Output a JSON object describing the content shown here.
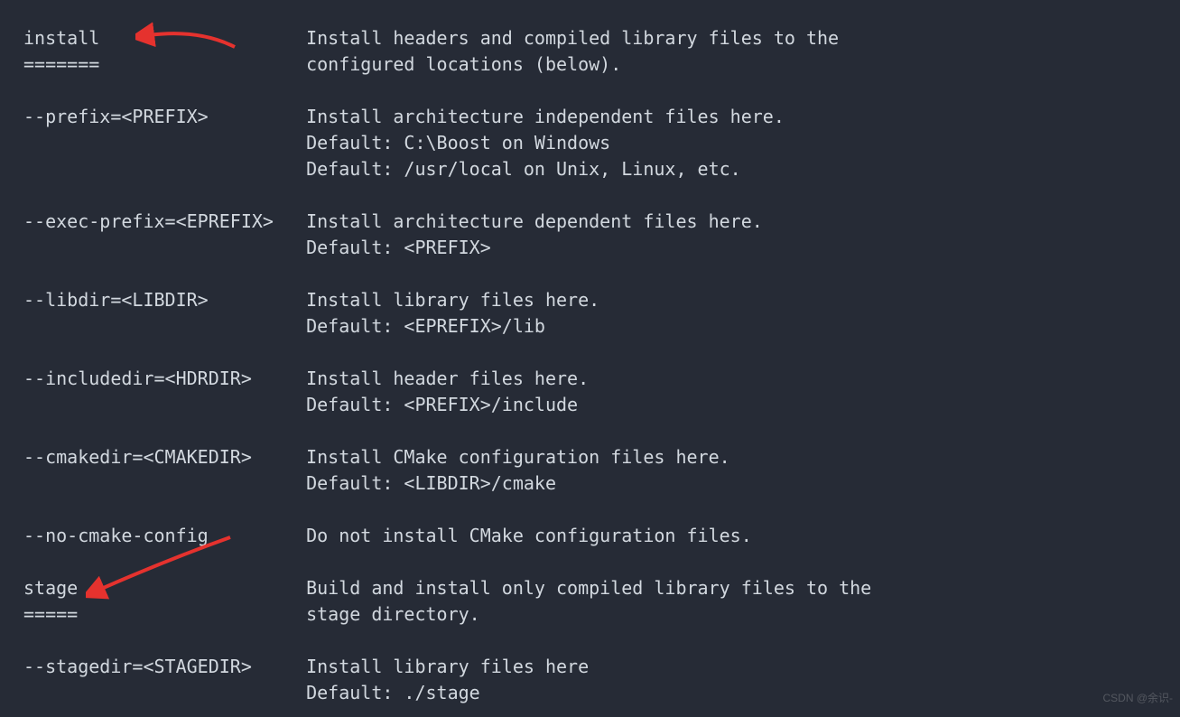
{
  "lines": [
    "install                   Install headers and compiled library files to the",
    "=======                   configured locations (below).",
    "",
    "--prefix=<PREFIX>         Install architecture independent files here.",
    "                          Default: C:\\Boost on Windows",
    "                          Default: /usr/local on Unix, Linux, etc.",
    "",
    "--exec-prefix=<EPREFIX>   Install architecture dependent files here.",
    "                          Default: <PREFIX>",
    "",
    "--libdir=<LIBDIR>         Install library files here.",
    "                          Default: <EPREFIX>/lib",
    "",
    "--includedir=<HDRDIR>     Install header files here.",
    "                          Default: <PREFIX>/include",
    "",
    "--cmakedir=<CMAKEDIR>     Install CMake configuration files here.",
    "                          Default: <LIBDIR>/cmake",
    "",
    "--no-cmake-config         Do not install CMake configuration files.",
    "",
    "stage                     Build and install only compiled library files to the",
    "=====                     stage directory.",
    "",
    "--stagedir=<STAGEDIR>     Install library files here",
    "                          Default: ./stage"
  ],
  "footer": "CSDN @余识-",
  "arrows": {
    "color": "#e5322e"
  }
}
